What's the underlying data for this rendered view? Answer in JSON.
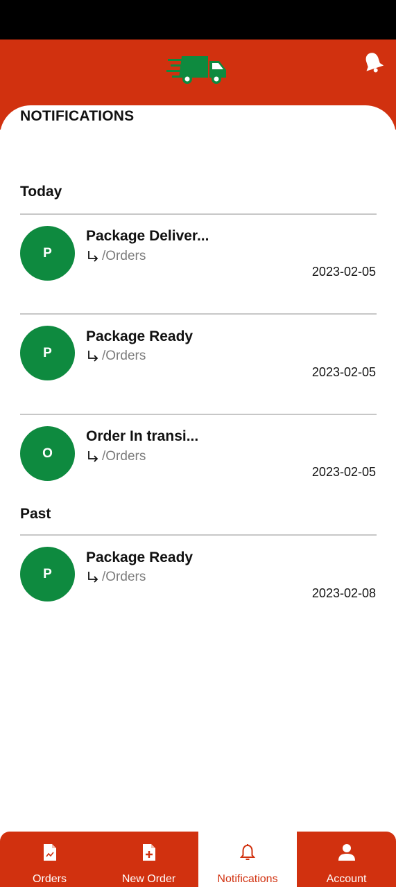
{
  "page": {
    "title": "NOTIFICATIONS"
  },
  "colors": {
    "brand_red": "#d1310f",
    "avatar_green": "#0e8a3f",
    "route_gray": "#7c7c7c"
  },
  "sections": [
    {
      "title": "Today",
      "items": [
        {
          "initial": "P",
          "title": "Package Deliver...",
          "route": "/Orders",
          "date": "2023-02-05"
        },
        {
          "initial": "P",
          "title": "Package Ready",
          "route": "/Orders",
          "date": "2023-02-05"
        },
        {
          "initial": "O",
          "title": "Order In transi...",
          "route": "/Orders",
          "date": "2023-02-05"
        }
      ]
    },
    {
      "title": "Past",
      "items": [
        {
          "initial": "P",
          "title": "Package Ready",
          "route": "/Orders",
          "date": "2023-02-08"
        }
      ]
    }
  ],
  "tabs": [
    {
      "label": "Orders",
      "icon": "document-icon"
    },
    {
      "label": "New Order",
      "icon": "add-document-icon"
    },
    {
      "label": "Notifications",
      "icon": "bell-icon",
      "active": true
    },
    {
      "label": "Account",
      "icon": "user-icon"
    }
  ],
  "icons": {
    "logo": "delivery-truck-icon",
    "header_action": "bell-icon",
    "route": "arrow-turn-down-right-icon"
  }
}
